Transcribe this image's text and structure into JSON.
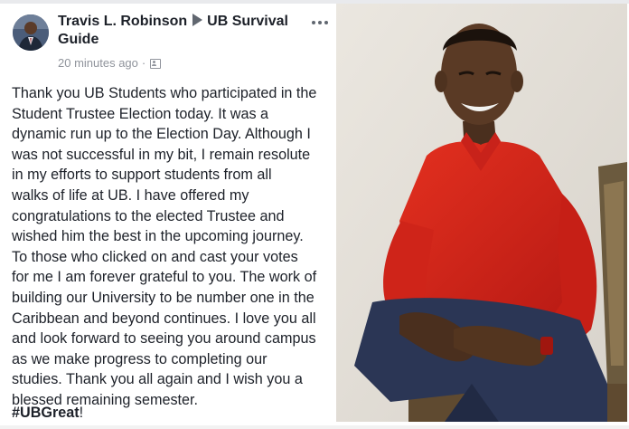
{
  "post": {
    "author": "Travis L. Robinson",
    "group": "UB Survival Guide",
    "timestamp": "20 minutes ago",
    "separator": "·",
    "audience_icon": "group-audience-icon",
    "more_icon": "more-options-icon",
    "body": "Thank you UB Students who participated in the\nStudent Trustee Election today. It was a\ndynamic run up to the Election Day. Although I\nwas not successful in my bit, I remain resolute\nin my efforts to support students from all\nwalks of life at UB. I have offered my\ncongratulations to the elected Trustee and\nwished him the best in the upcoming journey.\nTo those who clicked on and cast your votes\nfor me I am forever grateful to you. The work of\nbuilding our University to be number one in the\nCaribbean and beyond continues. I love you all\nand look forward to seeing you around campus\nas we make progress to completing our\nstudies. Thank you all again and I wish you a\nblessed remaining semester.",
    "hashtag": "#UBGreat",
    "hashtag_suffix": "!"
  },
  "colors": {
    "text": "#1d2129",
    "meta": "#90949c",
    "shirt": "#d9261c",
    "pants": "#2b3655",
    "background_photo": "#e3dfd8"
  }
}
